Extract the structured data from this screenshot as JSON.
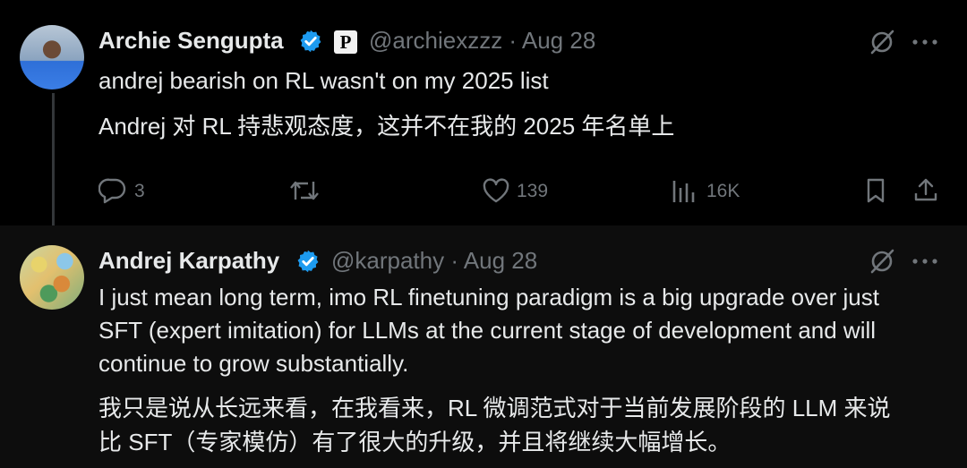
{
  "tweet1": {
    "author_name": "Archie Sengupta",
    "handle_date": "@archiexzzz · Aug 28",
    "text_en": "andrej bearish on RL wasn't on my 2025 list",
    "text_zh": "Andrej 对 RL 持悲观态度，这并不在我的 2025 年名单上",
    "badge_letter": "P",
    "metrics": {
      "replies": "3",
      "likes": "139",
      "views": "16K"
    }
  },
  "tweet2": {
    "author_name": "Andrej Karpathy",
    "handle_date": "@karpathy · Aug 28",
    "text_en_lines": [
      "I just mean long term, imo RL finetuning paradigm is a big upgrade over just",
      "SFT (expert imitation) for LLMs at the current stage of development and will",
      "continue to grow substantially."
    ],
    "text_zh_lines": [
      "我只是说从长远来看，在我看来，RL 微调范式对于当前发展阶段的 LLM 来说",
      "比 SFT（专家模仿）有了很大的升级，并且将继续大幅增长。"
    ]
  },
  "icons": [
    "verified-badge-icon",
    "grok-icon",
    "more-icon",
    "reply-icon",
    "retweet-icon",
    "like-icon",
    "views-icon",
    "bookmark-icon",
    "share-icon"
  ],
  "colors": {
    "verified": "#1d9bf0",
    "muted": "#71767b",
    "text": "#e7e9ea",
    "background": "#000000"
  }
}
